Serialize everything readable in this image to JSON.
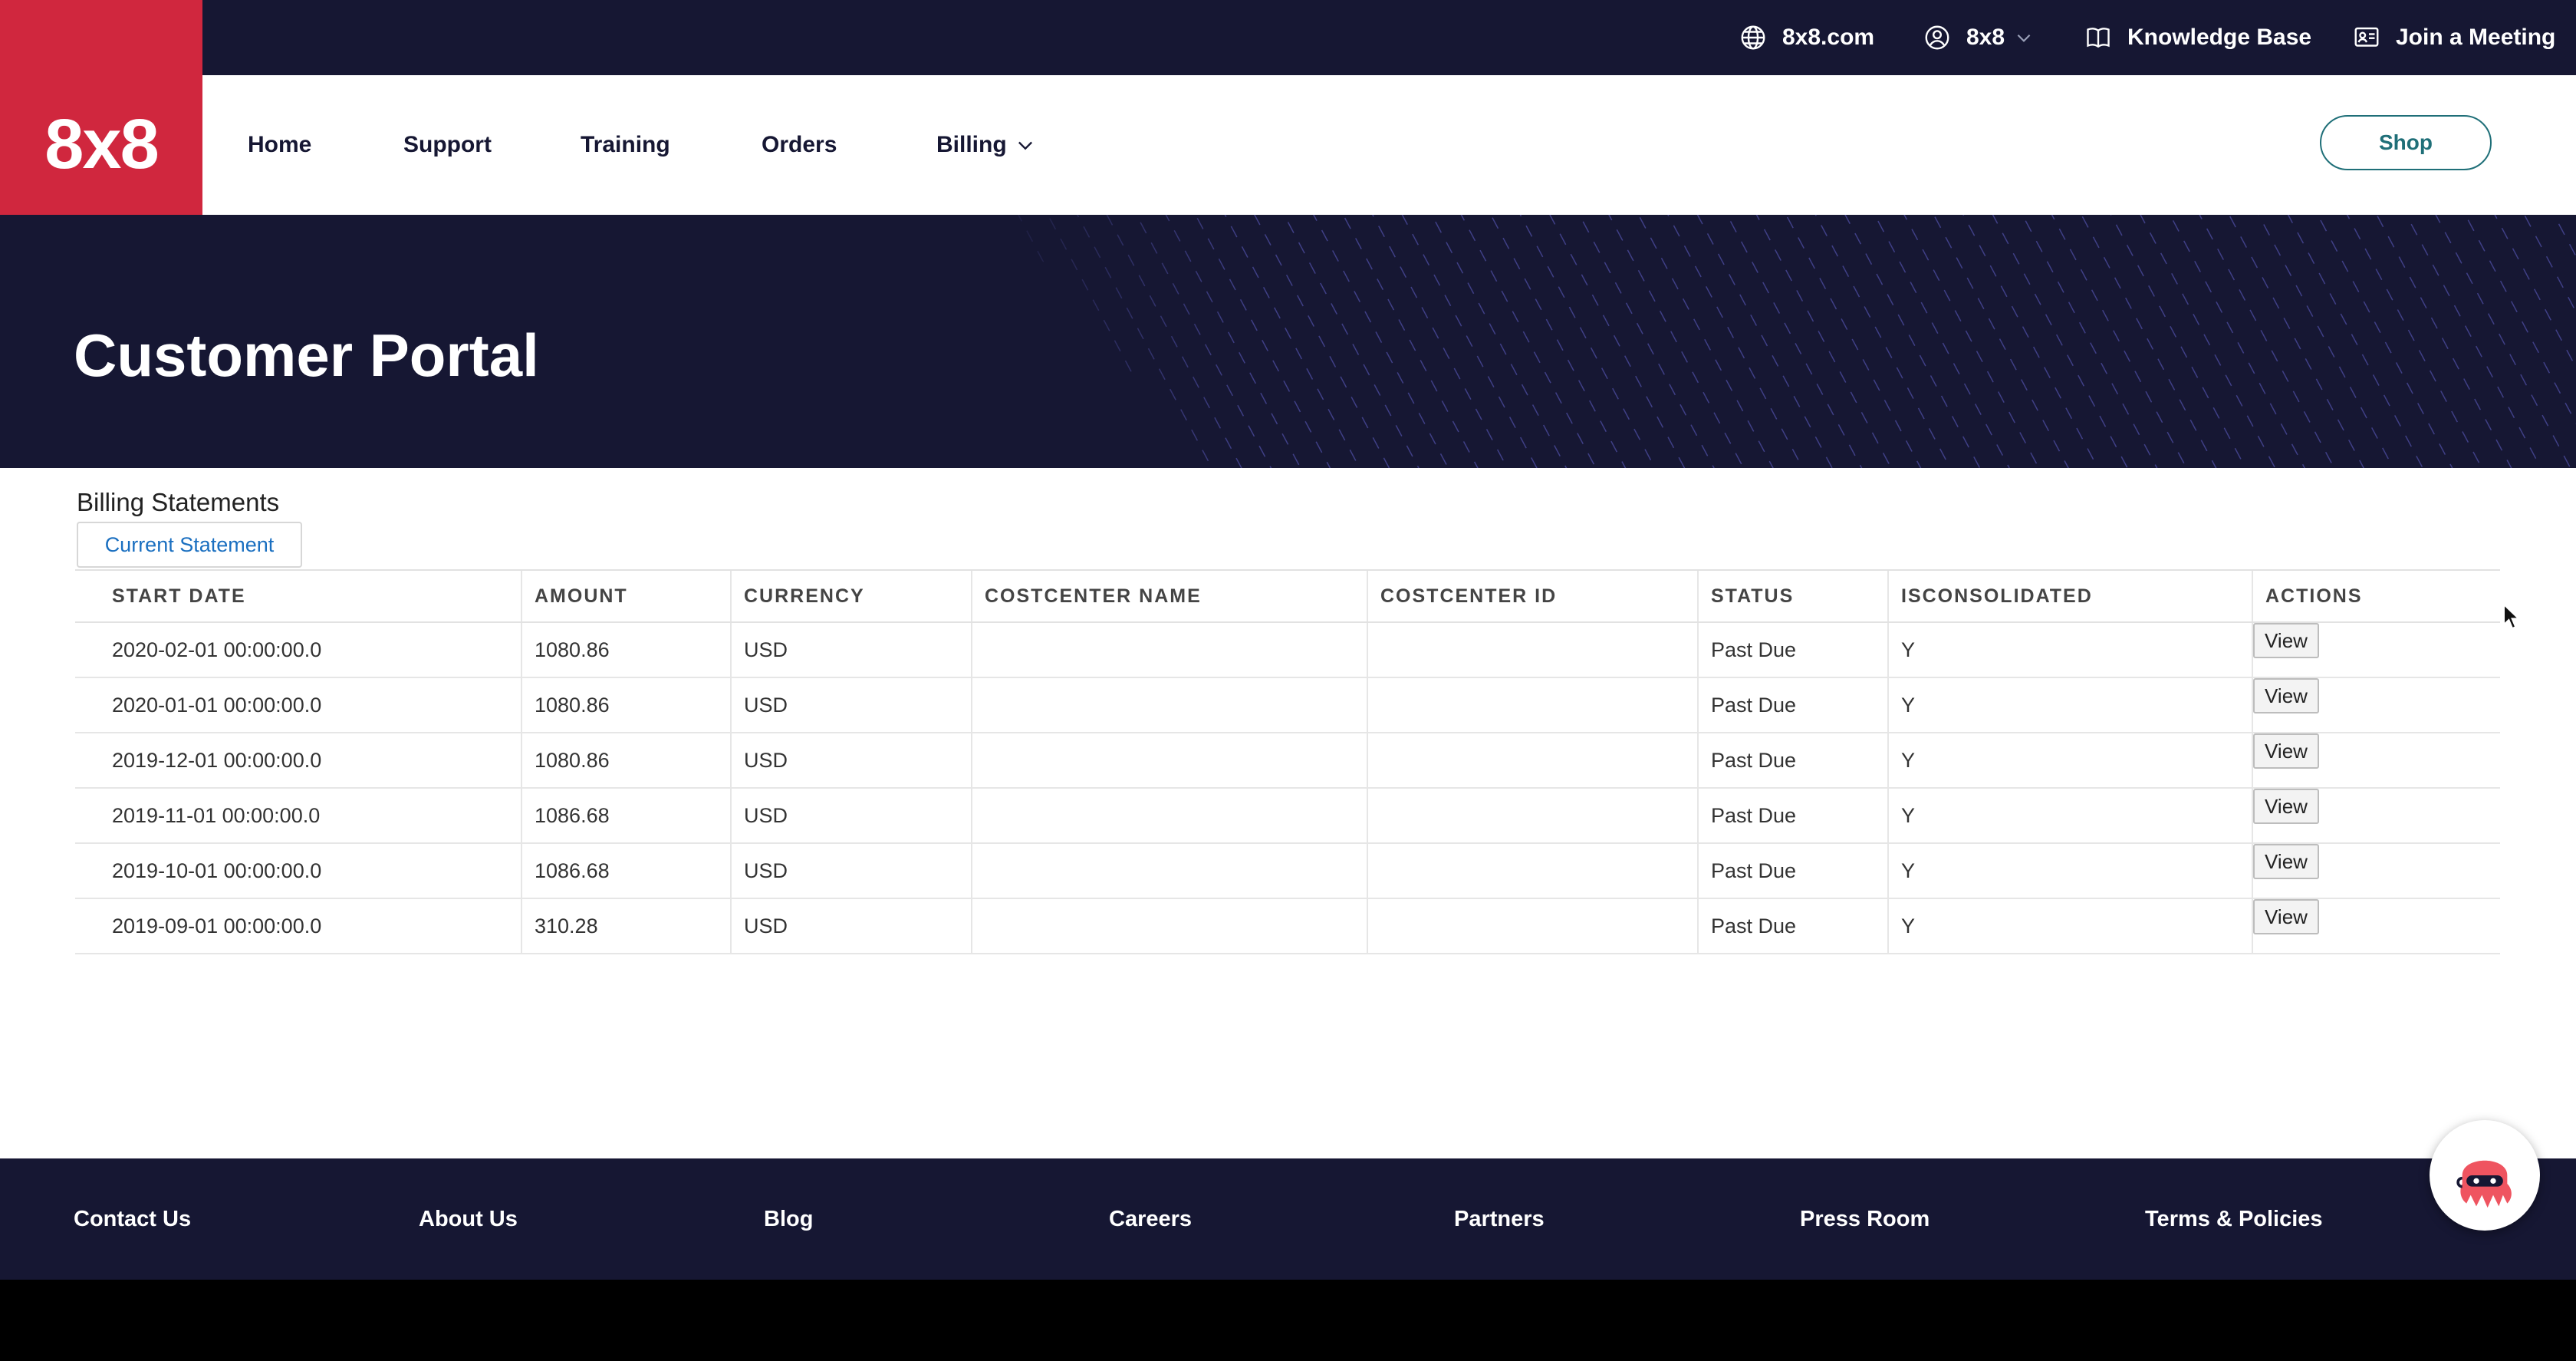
{
  "topbar": {
    "links": [
      {
        "label": "8x8.com",
        "icon": "globe-icon"
      },
      {
        "label": "8x8",
        "icon": "user-icon",
        "has_dropdown": true
      },
      {
        "label": "Knowledge Base",
        "icon": "book-icon"
      },
      {
        "label": "Join a Meeting",
        "icon": "meeting-icon"
      }
    ]
  },
  "brand": {
    "logo_text": "8x8",
    "color": "#d0273e"
  },
  "nav": {
    "items": [
      {
        "label": "Home"
      },
      {
        "label": "Support"
      },
      {
        "label": "Training"
      },
      {
        "label": "Orders"
      },
      {
        "label": "Billing",
        "has_dropdown": true
      }
    ],
    "shop_label": "Shop"
  },
  "hero": {
    "title": "Customer Portal"
  },
  "billing": {
    "section_title": "Billing Statements",
    "tab_label": "Current Statement",
    "columns": [
      "START DATE",
      "AMOUNT",
      "CURRENCY",
      "COSTCENTER NAME",
      "COSTCENTER ID",
      "STATUS",
      "ISCONSOLIDATED",
      "ACTIONS"
    ],
    "rows": [
      {
        "start_date": "2020-02-01 00:00:00.0",
        "amount": "1080.86",
        "currency": "USD",
        "costcenter_name": "",
        "costcenter_id": "",
        "status": "Past Due",
        "isconsolidated": "Y",
        "action": "View"
      },
      {
        "start_date": "2020-01-01 00:00:00.0",
        "amount": "1080.86",
        "currency": "USD",
        "costcenter_name": "",
        "costcenter_id": "",
        "status": "Past Due",
        "isconsolidated": "Y",
        "action": "View"
      },
      {
        "start_date": "2019-12-01 00:00:00.0",
        "amount": "1080.86",
        "currency": "USD",
        "costcenter_name": "",
        "costcenter_id": "",
        "status": "Past Due",
        "isconsolidated": "Y",
        "action": "View"
      },
      {
        "start_date": "2019-11-01 00:00:00.0",
        "amount": "1086.68",
        "currency": "USD",
        "costcenter_name": "",
        "costcenter_id": "",
        "status": "Past Due",
        "isconsolidated": "Y",
        "action": "View"
      },
      {
        "start_date": "2019-10-01 00:00:00.0",
        "amount": "1086.68",
        "currency": "USD",
        "costcenter_name": "",
        "costcenter_id": "",
        "status": "Past Due",
        "isconsolidated": "Y",
        "action": "View"
      },
      {
        "start_date": "2019-09-01 00:00:00.0",
        "amount": "310.28",
        "currency": "USD",
        "costcenter_name": "",
        "costcenter_id": "",
        "status": "Past Due",
        "isconsolidated": "Y",
        "action": "View"
      }
    ]
  },
  "footer": {
    "links": [
      "Contact Us",
      "About Us",
      "Blog",
      "Careers",
      "Partners",
      "Press Room",
      "Terms & Policies"
    ]
  },
  "chat": {
    "icon": "chat-assistant-icon"
  },
  "colors": {
    "navy": "#161733",
    "brand_red": "#d0273e",
    "shop_teal": "#1f6f78",
    "link_blue": "#1a6fc0"
  }
}
